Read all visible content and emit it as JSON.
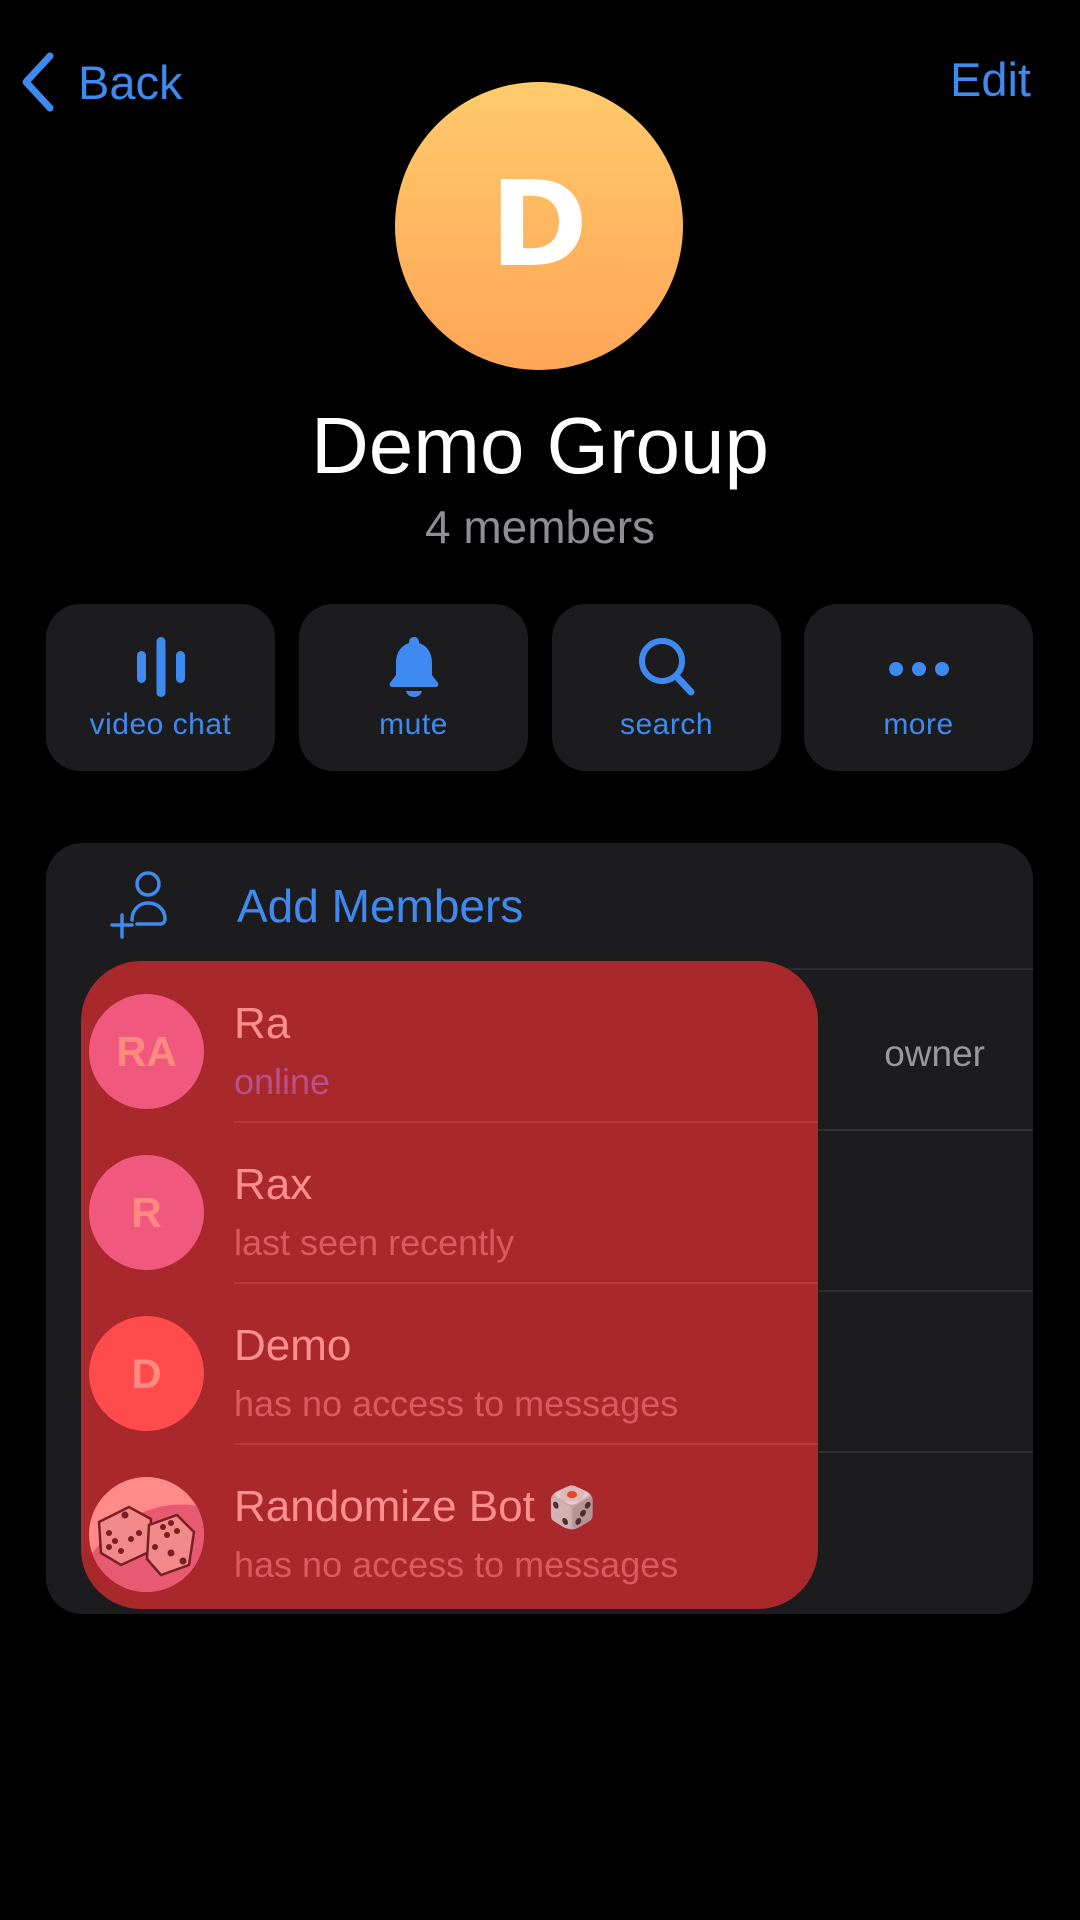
{
  "nav": {
    "back_label": "Back",
    "edit_label": "Edit"
  },
  "group": {
    "avatar_letter": "D",
    "avatar_gradient": [
      "#ffcb6b",
      "#ffa657"
    ],
    "title": "Demo Group",
    "subtitle": "4 members"
  },
  "actions": [
    {
      "icon": "voice-chat-bars-icon",
      "label": "video chat"
    },
    {
      "icon": "bell-icon",
      "label": "mute"
    },
    {
      "icon": "search-icon",
      "label": "search"
    },
    {
      "icon": "ellipsis-icon",
      "label": "more"
    }
  ],
  "members_section": {
    "add_members_label": "Add Members",
    "owner_badge": "owner",
    "members": [
      {
        "initials": "RA",
        "name": "Ra",
        "status": "online",
        "avatar_color": "#f0587e"
      },
      {
        "initials": "R",
        "name": "Rax",
        "status": "last seen recently",
        "avatar_color": "#f0587e"
      },
      {
        "initials": "D",
        "name": "Demo",
        "status": "has no access to messages",
        "avatar_color": "#ff4b4b"
      },
      {
        "initials": "",
        "name": "Randomize Bot",
        "name_emoji": "🎲",
        "status": "has no access to messages",
        "avatar_color": "#ff8a8a"
      }
    ]
  },
  "colors": {
    "accent": "#3e8af0",
    "background": "#000000",
    "card": "#1c1c1e",
    "secondary_text": "#8e8e93",
    "highlight_overlay": "#a8282c"
  }
}
